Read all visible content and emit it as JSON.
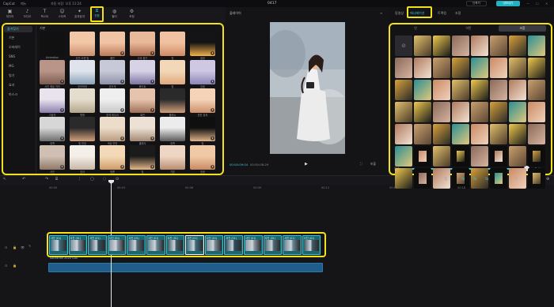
{
  "topbar": {
    "logo": "CapCut",
    "menu": "메뉴",
    "autosave": "자동 저장: 오후 11:24",
    "title": "0417",
    "shortcut_label": "단축키",
    "export_label": "내보내기",
    "win_min": "—",
    "win_max": "☐",
    "win_close": "✕"
  },
  "toolbar": {
    "items": [
      {
        "icon": "media-icon",
        "glyph": "▣",
        "label": "미디어"
      },
      {
        "icon": "audio-icon",
        "glyph": "♪",
        "label": "오디오"
      },
      {
        "icon": "text-icon",
        "glyph": "T",
        "label": "텍스트"
      },
      {
        "icon": "sticker-icon",
        "glyph": "☺",
        "label": "스티커"
      },
      {
        "icon": "effects-icon",
        "glyph": "✦",
        "label": "효과효과"
      },
      {
        "icon": "transition-icon",
        "glyph": "⧖",
        "label": "전환"
      },
      {
        "icon": "filter-icon",
        "glyph": "◍",
        "label": "필터"
      },
      {
        "icon": "adjust-icon",
        "glyph": "⚙",
        "label": "조정"
      }
    ],
    "active_index": 5
  },
  "categories": {
    "items": [
      "즐겨찾기",
      "기본",
      "오버레이",
      "SNS",
      "MG",
      "빛기",
      "효과",
      "마스크"
    ],
    "selected_index": 0
  },
  "effects": {
    "section_title": "기본",
    "items": [
      {
        "label": "Animation",
        "colors": [
          "#111111",
          "#111111"
        ]
      },
      {
        "label": "흐린 오렌 빛",
        "colors": [
          "#f1c7a8",
          "#c98d6e"
        ]
      },
      {
        "label": "풀린",
        "colors": [
          "#f2c4a6",
          "#b97a58"
        ]
      },
      {
        "label": "주의 줄기",
        "colors": [
          "#e8b99a",
          "#a9694d"
        ]
      },
      {
        "label": "빛",
        "colors": [
          "#f0c2a2",
          "#cf8a63"
        ]
      },
      {
        "label": "발광",
        "colors": [
          "#141414",
          "#f4b14a"
        ]
      },
      {
        "label": "사진 예술 처리",
        "colors": [
          "#b99489",
          "#7b5c50"
        ]
      },
      {
        "label": "흐릿하게",
        "colors": [
          "#dfe4ec",
          "#8aa0b8"
        ]
      },
      {
        "label": "흐리게",
        "colors": [
          "#c7c9d8",
          "#8d8fa6"
        ]
      },
      {
        "label": "화이트",
        "colors": [
          "#d8d2e6",
          "#7c74a0"
        ]
      },
      {
        "label": "빛",
        "colors": [
          "#f2d8b8",
          "#e0a87d"
        ]
      },
      {
        "label": "흐림",
        "colors": [
          "#cfc8e3",
          "#8c84b6"
        ]
      },
      {
        "label": "그림자",
        "colors": [
          "#e9e3ee",
          "#8a7fae"
        ]
      },
      {
        "label": "원형",
        "colors": [
          "#e4dccd",
          "#b2a58a"
        ]
      },
      {
        "label": "흰색 테두리",
        "colors": [
          "#efefef",
          "#c7c7c7"
        ]
      },
      {
        "label": "회전",
        "colors": [
          "#e6c3ac",
          "#9f6f57"
        ]
      },
      {
        "label": "플래시",
        "colors": [
          "#2a2a2a",
          "#d3a07c"
        ]
      },
      {
        "label": "흐린 효과",
        "colors": [
          "#f4d3b8",
          "#cd8f6b"
        ]
      },
      {
        "label": "흑백",
        "colors": [
          "#d7d7d7",
          "#6d6d6d"
        ]
      },
      {
        "label": "빛 번짐",
        "colors": [
          "#2a2a2a",
          "#d4a07a"
        ]
      },
      {
        "label": "색상 반전",
        "colors": [
          "#ecdcca",
          "#b99b7f"
        ]
      },
      {
        "label": "클래식",
        "colors": [
          "#ede1d6",
          "#a38873"
        ]
      },
      {
        "label": "흑백",
        "colors": [
          "#ececec",
          "#5a5a5a"
        ]
      },
      {
        "label": "빛",
        "colors": [
          "#0f0f0f",
          "#e2b48a"
        ]
      },
      {
        "label": "사진",
        "colors": [
          "#cfc0b3",
          "#8e7868"
        ]
      },
      {
        "label": "효과",
        "colors": [
          "#f4efe8",
          "#c6b6a6"
        ]
      },
      {
        "label": "필름",
        "colors": [
          "#f3d9b8",
          "#d09b66"
        ]
      },
      {
        "label": "빛",
        "colors": [
          "#1b1b1b",
          "#e4b88a"
        ]
      },
      {
        "label": "기본",
        "colors": [
          "#efd6c4",
          "#b88d72"
        ]
      },
      {
        "label": "흐림",
        "colors": [
          "#f0c9a6",
          "#c98a62"
        ]
      }
    ]
  },
  "player": {
    "title": "플레이어",
    "menu_icon": "≡",
    "time_current": "00:00:09:04",
    "time_total": "00:00:08:29",
    "play_glyph": "▶",
    "ratio": "비율",
    "fit_icon": "⛶"
  },
  "right_panel": {
    "tabs": [
      "동영상",
      "애니메이션",
      "트랙킹",
      "조정"
    ],
    "selected_tab": 1,
    "segments": [
      "인",
      "아웃",
      "조합"
    ],
    "selected_segment": 2,
    "none_glyph": "⊘",
    "anim_count": 60,
    "duration_label": "지속",
    "duration_value": "2.4s",
    "duration_fraction": 0.97
  },
  "timeline": {
    "tools": [
      "↖",
      "↶",
      "↷",
      "⌸",
      "⋮",
      "▢",
      "◌",
      "⊙"
    ],
    "right_tools": [
      "🎙",
      "⇆",
      "⇆",
      "⇆",
      "⇆",
      "⊖",
      "⊕"
    ],
    "ruler": [
      "00:00",
      "00:03",
      "00:06",
      "00:09",
      "00:12",
      "00:15",
      "00:18"
    ],
    "clip_label": "사진 (01)",
    "clip_count": 14,
    "selected_clip": 7,
    "audio_label": "Sound Bit 2020 CAS",
    "track_ctrls": [
      "⊡",
      "🔒",
      "👁",
      "✎"
    ]
  }
}
